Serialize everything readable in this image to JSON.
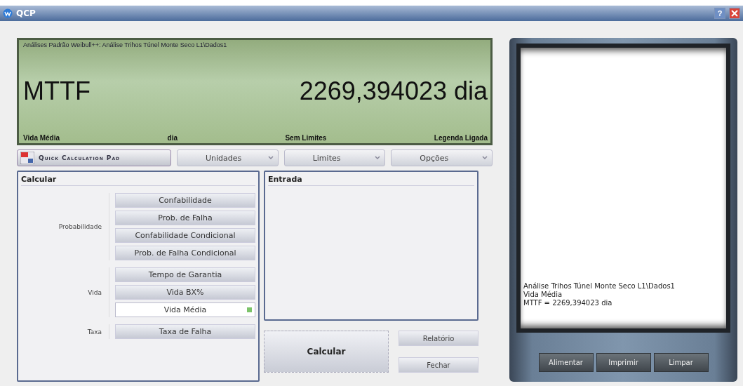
{
  "window": {
    "title": "QCP",
    "help": "?"
  },
  "display": {
    "source": "Análises Padrão Weibull++: Análise Trihos Túnel Monte Seco L1\\Dados1",
    "metric": "MTTF",
    "value": "2269,394023 dia",
    "status": [
      "Vida Média",
      "dia",
      "Sem Limites",
      "Legenda Ligada"
    ]
  },
  "toolbar": {
    "brand": "Quick Calculation Pad",
    "menus": [
      "Unidades",
      "Limites",
      "Opções"
    ]
  },
  "calcular": {
    "title": "Calcular",
    "groups": [
      {
        "label": "Probabilidade",
        "items": [
          {
            "label": "Confabilidade",
            "selected": false
          },
          {
            "label": "Prob. de Falha",
            "selected": false
          },
          {
            "label": "Confabilidade Condicional",
            "selected": false
          },
          {
            "label": "Prob. de Falha Condicional",
            "selected": false
          }
        ]
      },
      {
        "label": "Vida",
        "items": [
          {
            "label": "Tempo de Garantia",
            "selected": false
          },
          {
            "label": "Vida BX%",
            "selected": false
          },
          {
            "label": "Vida Média",
            "selected": true
          }
        ]
      },
      {
        "label": "Taxa",
        "items": [
          {
            "label": "Taxa de Falha",
            "selected": false
          }
        ]
      }
    ]
  },
  "entrada": {
    "title": "Entrada"
  },
  "actions": {
    "primary": "Calcular",
    "secondary": [
      "Relatório",
      "Fechar"
    ]
  },
  "printer": {
    "lines": [
      "Análise Trihos Túnel Monte Seco L1\\Dados1",
      "Vida Média",
      "MTTF = 2269,394023 dia"
    ],
    "buttons": [
      "Alimentar",
      "Imprimir",
      "Limpar"
    ]
  }
}
